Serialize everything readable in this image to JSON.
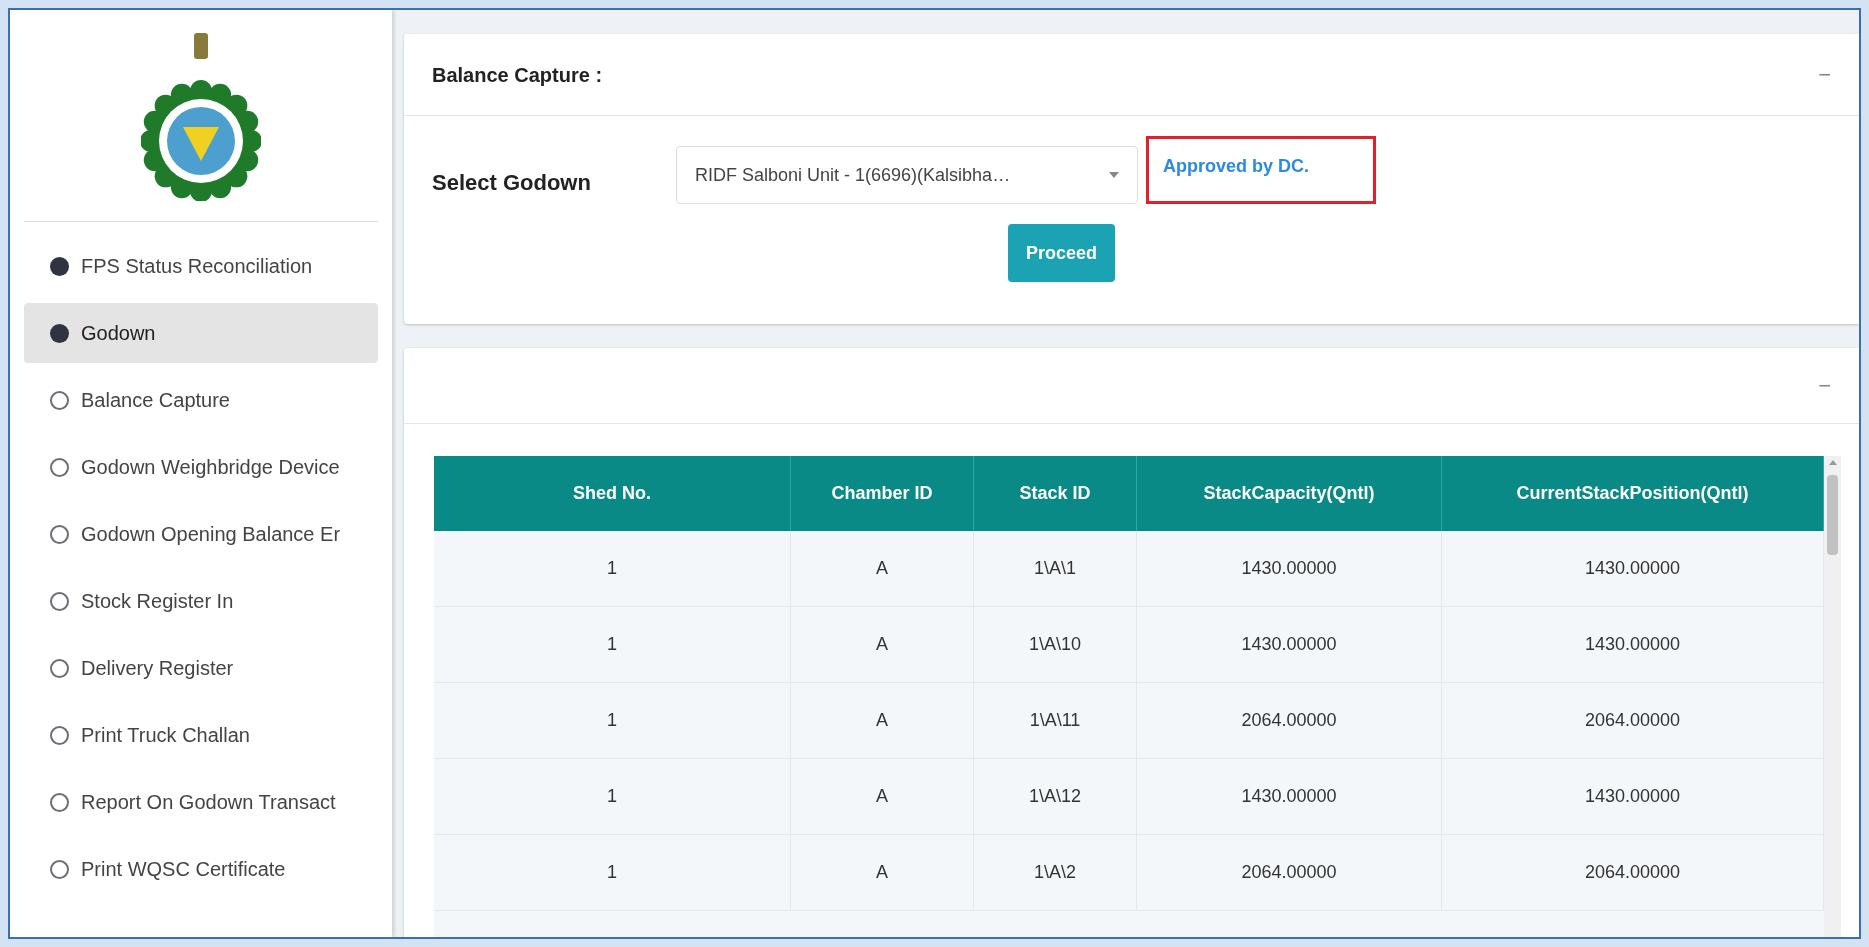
{
  "sidebar": {
    "items": [
      {
        "label": "FPS Status Reconciliation",
        "kind": "group",
        "selected": false
      },
      {
        "label": "Godown",
        "kind": "group",
        "selected": true
      },
      {
        "label": "Balance Capture",
        "kind": "link",
        "selected": false
      },
      {
        "label": "Godown Weighbridge Device",
        "kind": "link",
        "selected": false
      },
      {
        "label": "Godown Opening Balance Er",
        "kind": "link",
        "selected": false
      },
      {
        "label": "Stock Register In",
        "kind": "link",
        "selected": false
      },
      {
        "label": "Delivery Register",
        "kind": "link",
        "selected": false
      },
      {
        "label": "Print Truck Challan",
        "kind": "link",
        "selected": false
      },
      {
        "label": "Report On Godown Transact",
        "kind": "link",
        "selected": false
      },
      {
        "label": "Print WQSC Certificate",
        "kind": "link",
        "selected": false
      }
    ]
  },
  "balance_card": {
    "title": "Balance Capture :",
    "collapse": "−",
    "field_label": "Select Godown",
    "godown_value": "RIDF Salboni Unit - 1(6696)(Kalsibha…",
    "status": "Approved by DC.",
    "button": "Proceed"
  },
  "table_card": {
    "collapse": "−",
    "table": {
      "columns": [
        "Shed No.",
        "Chamber ID",
        "Stack ID",
        "StackCapacity(Qntl)",
        "CurrentStackPosition(Qntl)"
      ],
      "rows": [
        [
          "1",
          "A",
          "1\\A\\1",
          "1430.00000",
          "1430.00000"
        ],
        [
          "1",
          "A",
          "1\\A\\10",
          "1430.00000",
          "1430.00000"
        ],
        [
          "1",
          "A",
          "1\\A\\11",
          "2064.00000",
          "2064.00000"
        ],
        [
          "1",
          "A",
          "1\\A\\12",
          "1430.00000",
          "1430.00000"
        ],
        [
          "1",
          "A",
          "1\\A\\2",
          "2064.00000",
          "2064.00000"
        ]
      ]
    }
  }
}
